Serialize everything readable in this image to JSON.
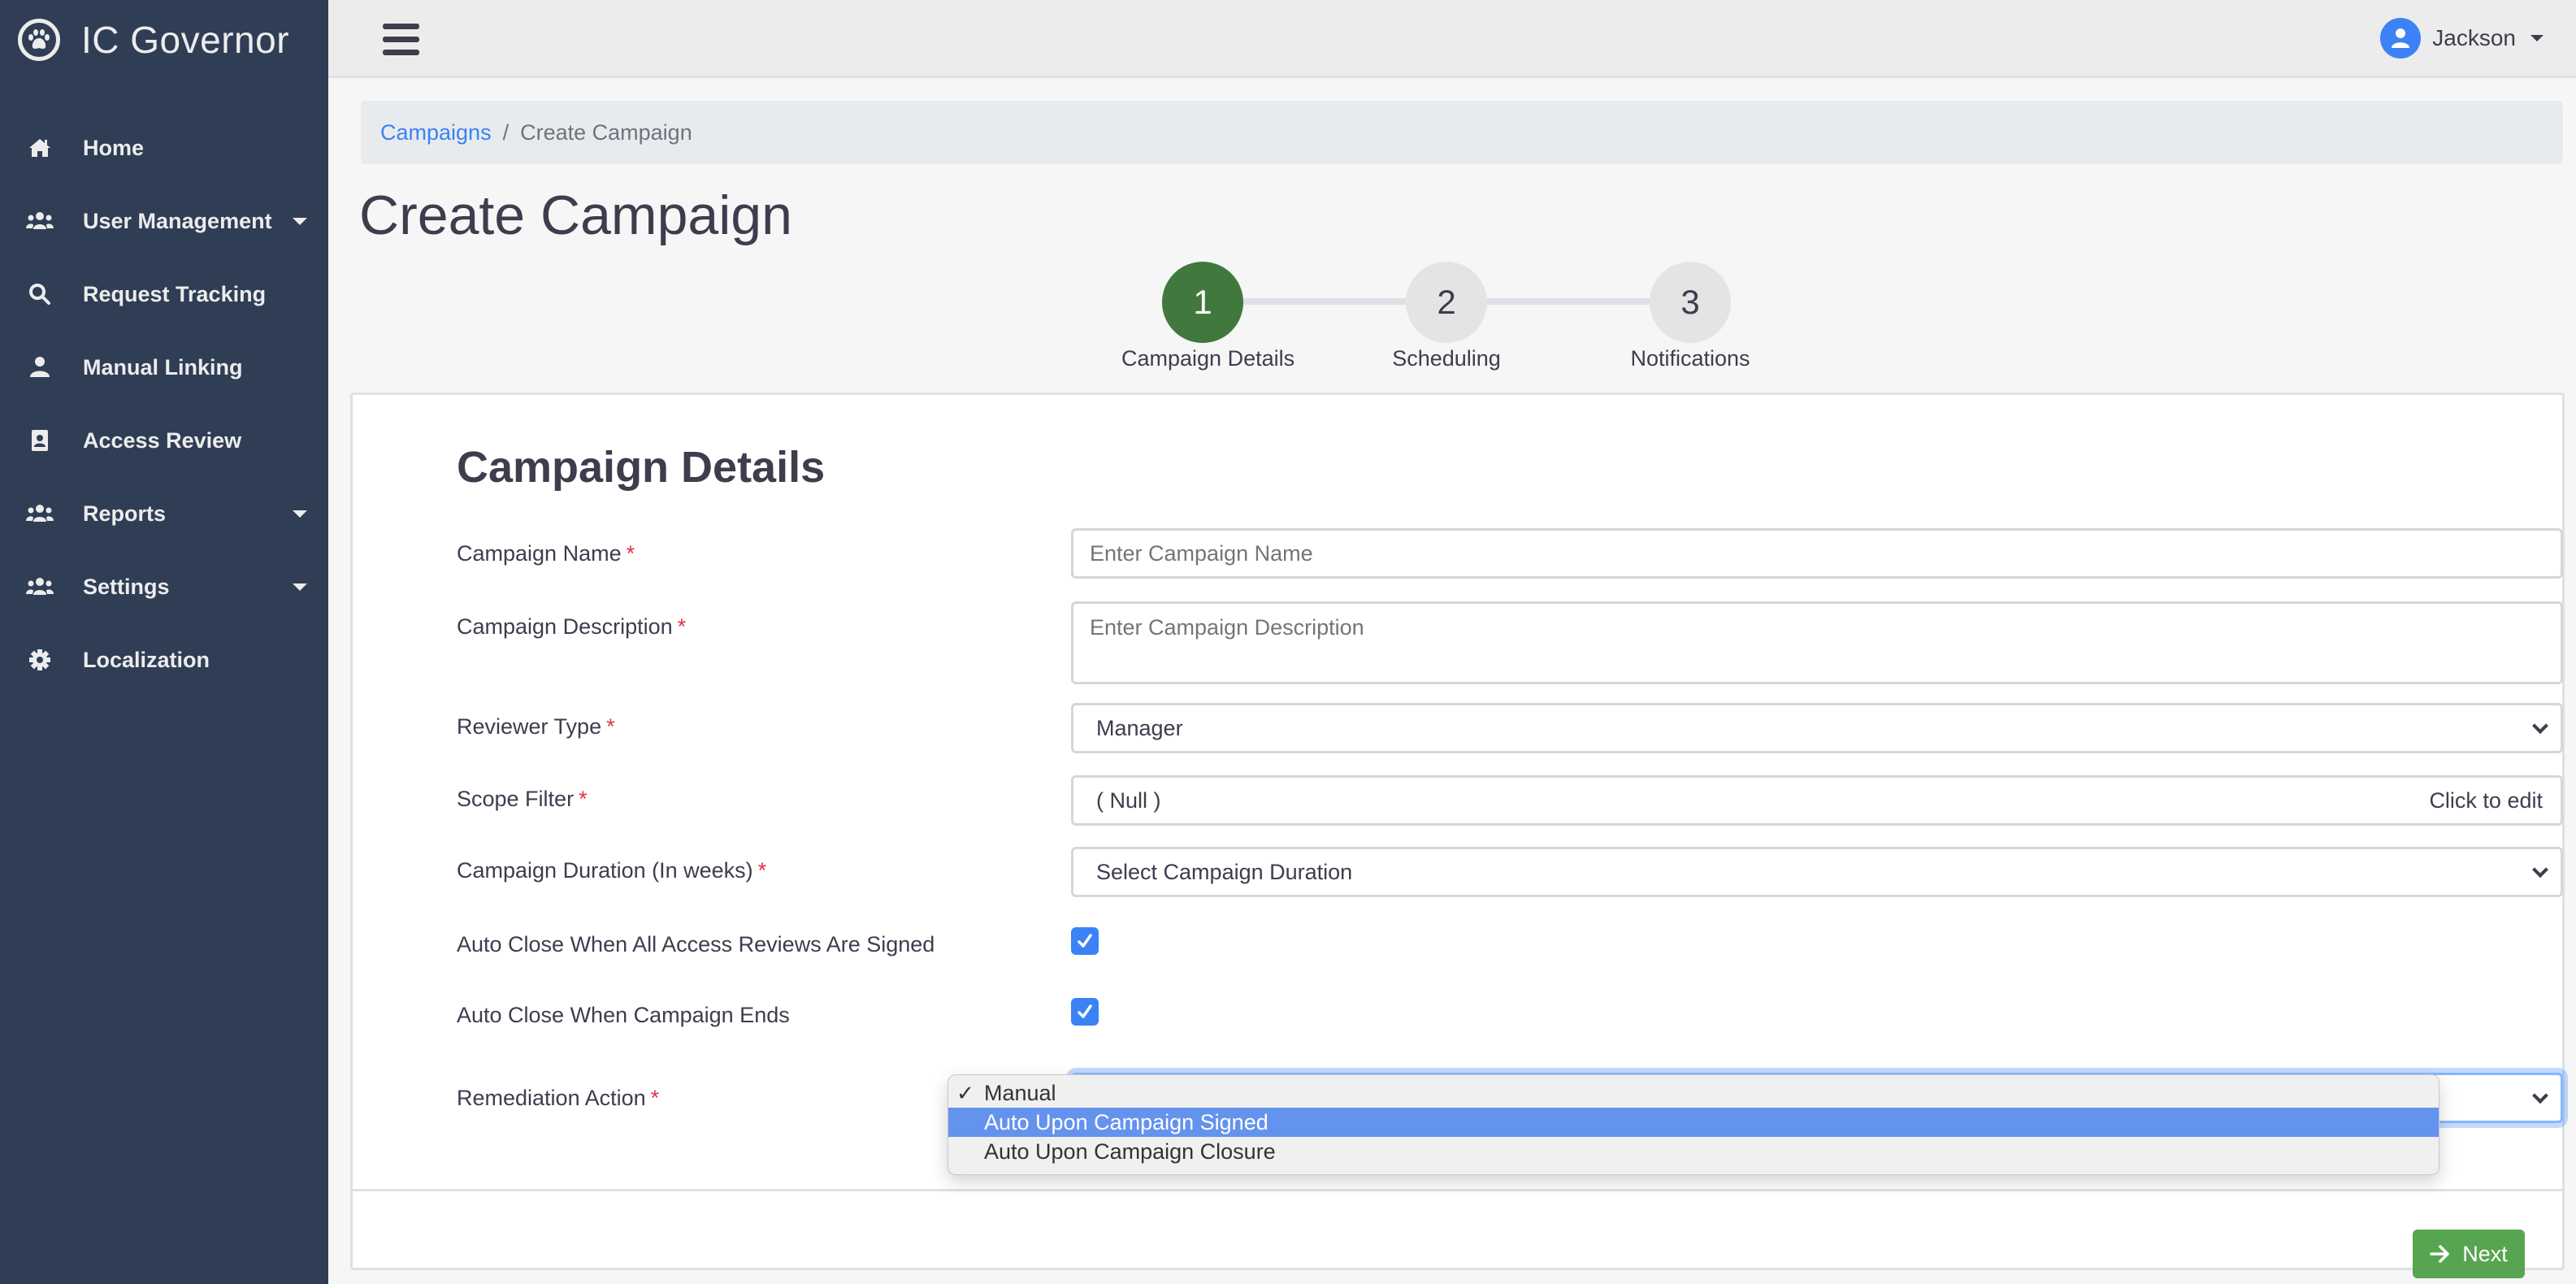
{
  "app": {
    "title": "IC Governor",
    "logo_icon": "paw-icon"
  },
  "sidebar": {
    "items": [
      {
        "label": "Home",
        "icon": "home-icon",
        "has_submenu": false
      },
      {
        "label": "User Management",
        "icon": "users-icon",
        "has_submenu": true
      },
      {
        "label": "Request Tracking",
        "icon": "search-icon",
        "has_submenu": false
      },
      {
        "label": "Manual Linking",
        "icon": "user-icon",
        "has_submenu": false
      },
      {
        "label": "Access Review",
        "icon": "id-badge-icon",
        "has_submenu": false
      },
      {
        "label": "Reports",
        "icon": "users-icon",
        "has_submenu": true
      },
      {
        "label": "Settings",
        "icon": "users-icon",
        "has_submenu": true
      },
      {
        "label": "Localization",
        "icon": "gear-icon",
        "has_submenu": false
      }
    ]
  },
  "topbar": {
    "menu_icon": "hamburger-icon",
    "user": {
      "name": "Jackson",
      "avatar_icon": "user-circle-icon"
    }
  },
  "breadcrumb": {
    "items": [
      {
        "label": "Campaigns",
        "link": true
      },
      {
        "label": "Create Campaign",
        "link": false
      }
    ],
    "separator": "/"
  },
  "page": {
    "title": "Create Campaign"
  },
  "stepper": {
    "current_step": 1,
    "steps": [
      {
        "number": "1",
        "label": "Campaign Details"
      },
      {
        "number": "2",
        "label": "Scheduling"
      },
      {
        "number": "3",
        "label": "Notifications"
      }
    ]
  },
  "form": {
    "section_title": "Campaign Details",
    "required_marker": "*",
    "campaign_name": {
      "label": "Campaign Name",
      "placeholder": "Enter Campaign Name",
      "value": ""
    },
    "campaign_description": {
      "label": "Campaign Description",
      "placeholder": "Enter Campaign Description",
      "value": ""
    },
    "reviewer_type": {
      "label": "Reviewer Type",
      "value": "Manager"
    },
    "scope_filter": {
      "label": "Scope Filter",
      "value": "( Null )",
      "action": "Click to edit"
    },
    "campaign_duration": {
      "label": "Campaign Duration (In weeks)",
      "value": "Select Campaign Duration"
    },
    "auto_close_signed": {
      "label": "Auto Close When All Access Reviews Are Signed",
      "checked": true
    },
    "auto_close_ends": {
      "label": "Auto Close When Campaign Ends",
      "checked": true
    },
    "remediation_action": {
      "label": "Remediation Action",
      "value": "Manual",
      "open": true,
      "options": [
        {
          "label": "Manual",
          "selected": true,
          "highlighted": false
        },
        {
          "label": "Auto Upon Campaign Signed",
          "selected": false,
          "highlighted": true
        },
        {
          "label": "Auto Upon Campaign Closure",
          "selected": false,
          "highlighted": false
        }
      ],
      "check_mark": "✓"
    }
  },
  "footer": {
    "next_label": "Next",
    "next_icon": "arrow-right-icon"
  },
  "colors": {
    "sidebar_bg": "#2f3d55",
    "accent_blue": "#3b82f6",
    "step_active": "#40783d",
    "next_button": "#58a551",
    "dropdown_highlight": "#6493ee",
    "required": "#dc3545"
  }
}
